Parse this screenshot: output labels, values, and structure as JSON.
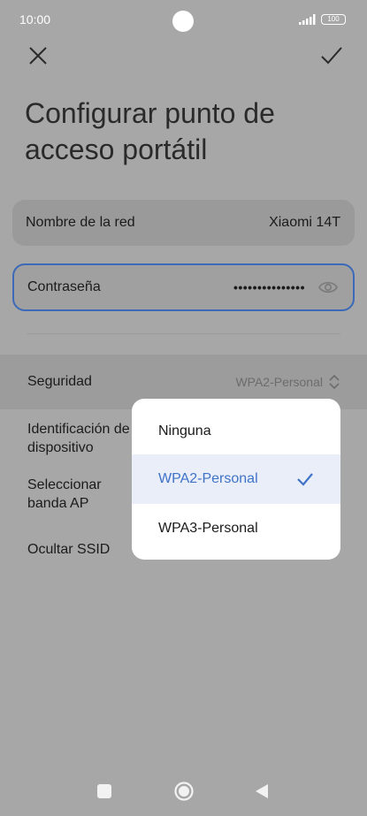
{
  "status_bar": {
    "time": "10:00",
    "battery": "100"
  },
  "header": {
    "title": "Configurar punto de acceso portátil"
  },
  "fields": {
    "ssid": {
      "label": "Nombre de la red",
      "value": "Xiaomi 14T"
    },
    "password": {
      "label": "Contraseña",
      "value": "•••••••••••••••"
    }
  },
  "security": {
    "label": "Seguridad",
    "value": "WPA2-Personal"
  },
  "settings": [
    {
      "label": "Identificación de dispositivo"
    },
    {
      "label": "Seleccionar banda AP"
    },
    {
      "label": "Ocultar SSID"
    }
  ],
  "dropdown": {
    "options": [
      {
        "label": "Ninguna",
        "selected": false
      },
      {
        "label": "WPA2-Personal",
        "selected": true
      },
      {
        "label": "WPA3-Personal",
        "selected": false
      }
    ]
  },
  "colors": {
    "accent": "#3f73c8",
    "scrim": "#a7a7a7",
    "focus_border": "#3d69b9"
  },
  "icons": [
    "close-icon",
    "check-icon",
    "eye-icon",
    "up-down-icon",
    "checkmark-icon",
    "square-icon",
    "circle-icon",
    "triangle-back-icon"
  ]
}
